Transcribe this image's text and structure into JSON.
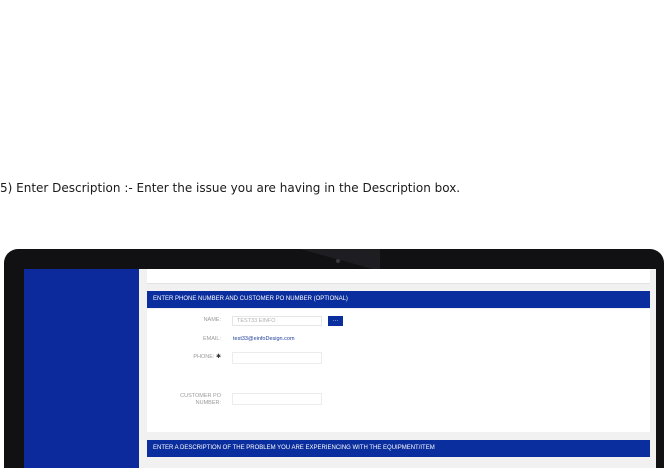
{
  "caption": "5) Enter Description :-  Enter the issue you are having in the Description box.",
  "phone_section": {
    "header": "ENTER PHONE NUMBER AND CUSTOMER PO NUMBER (OPTIONAL)",
    "name_label": "NAME:",
    "name_value": "TEST33 EINFO",
    "lookup_button_label": "···",
    "email_label": "EMAIL:",
    "email_value": "test33@einfoDesign.com",
    "phone_label": "PHONE:",
    "required_mark": "✱",
    "phone_value": "",
    "po_label_line1": "CUSTOMER PO",
    "po_label_line2": "NUMBER:",
    "po_value": ""
  },
  "description_section": {
    "header": "ENTER A DESCRIPTION OF THE PROBLEM YOU ARE EXPERIENCING WITH THE EQUIPMENT/ITEM"
  },
  "colors": {
    "sidebar": "#0c2a9b",
    "header_bar": "#0b2e9e",
    "email_text": "#1f3f9a"
  }
}
